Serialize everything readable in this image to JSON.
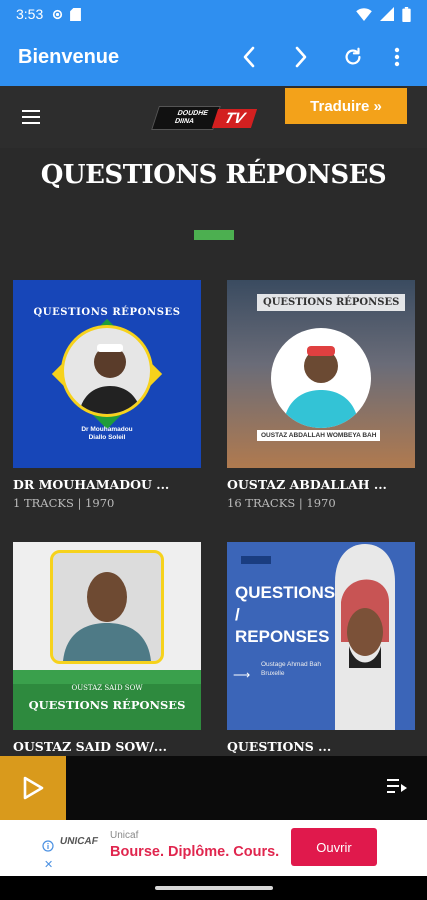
{
  "status_bar": {
    "time": "3:53"
  },
  "app_bar": {
    "title": "Bienvenue"
  },
  "site": {
    "logo_line1": "DOUDHE",
    "logo_line2": "DIINA",
    "logo_tv": "TV",
    "translate_label": "Traduire »",
    "page_title": "QUESTIONS RÉPONSES"
  },
  "cards": [
    {
      "title": "DR MOUHAMADOU ...",
      "meta": "1 TRACKS | 1970",
      "thumb_label": "QUESTIONS RÉPONSES",
      "thumb_caption1": "Dr Mouhamadou",
      "thumb_caption2": "Diallo Soleil"
    },
    {
      "title": "OUSTAZ ABDALLAH ...",
      "meta": "16 TRACKS | 1970",
      "thumb_label": "QUESTIONS RÉPONSES",
      "thumb_caption1": "OUSTAZ ABDALLAH WOMBEYA BAH"
    },
    {
      "title": "OUSTAZ SAID SOW/...",
      "meta": "",
      "thumb_label": "QUESTIONS RÉPONSES",
      "thumb_caption1": "OUSTAZ SAID SOW"
    },
    {
      "title": "QUESTIONS ...",
      "meta": "",
      "thumb_label": "QUESTIONS / REPONSES",
      "thumb_caption1": "Oustage Ahmad Bah",
      "thumb_caption2": "Bruxelle"
    }
  ],
  "ad": {
    "brand_logo": "UNICAF",
    "advertiser": "Unicaf",
    "text": "Bourse. Diplôme. Cours.",
    "cta": "Ouvrir"
  },
  "colors": {
    "app_bar": "#2f8ff0",
    "accent_orange": "#f3a21a",
    "green_bar": "#4caf50",
    "ad_red": "#e0194c"
  }
}
